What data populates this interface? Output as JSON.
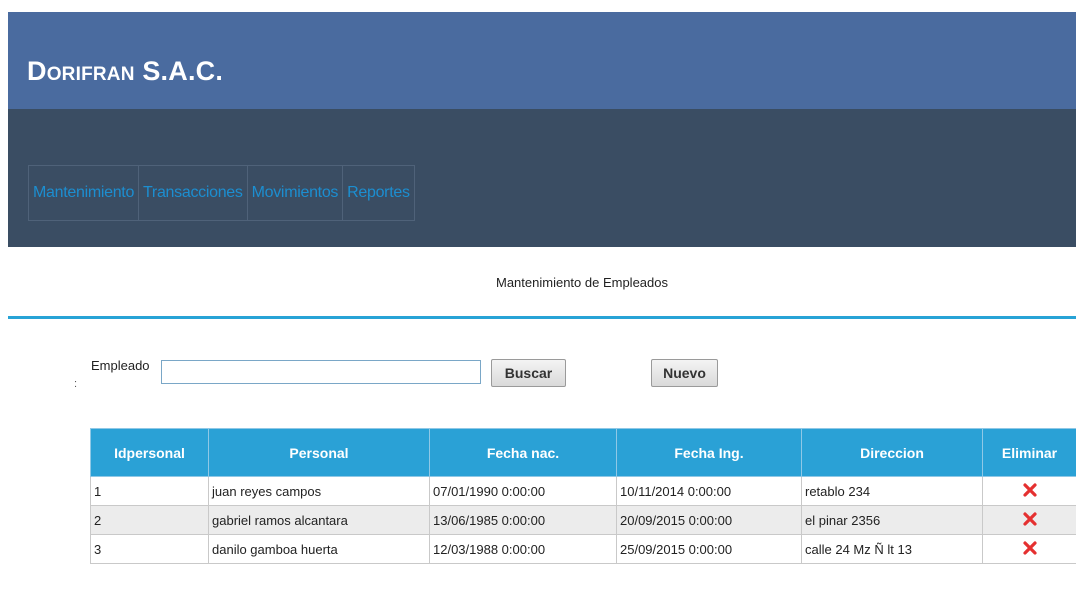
{
  "header": {
    "brand": "Dorifran S.A.C."
  },
  "menu": [
    "Mantenimiento",
    "Transacciones",
    "Movimientos",
    "Reportes"
  ],
  "page_title": "Mantenimiento de Empleados",
  "search": {
    "label": "Empleado",
    "colon": ":",
    "value": "",
    "button": "Buscar",
    "new_button": "Nuevo"
  },
  "table": {
    "columns": [
      "Idpersonal",
      "Personal",
      "Fecha nac.",
      "Fecha Ing.",
      "Direccion",
      "Eliminar"
    ],
    "rows": [
      [
        "1",
        "juan reyes campos",
        "07/01/1990 0:00:00",
        "10/11/2014 0:00:00",
        "retablo 234"
      ],
      [
        "2",
        "gabriel ramos alcantara",
        "13/06/1985 0:00:00",
        "20/09/2015 0:00:00",
        "el pinar 2356"
      ],
      [
        "3",
        "danilo gamboa huerta",
        "12/03/1988 0:00:00",
        "25/09/2015 0:00:00",
        "calle 24 Mz Ñ lt 13"
      ]
    ],
    "delete_icon": "delete-x-icon",
    "delete_color": "#e53030"
  },
  "colors": {
    "header": "#4a6b9f",
    "navbar": "#3a4d63",
    "accent": "#2aa1d6",
    "menu_text": "#1c8ed0"
  }
}
